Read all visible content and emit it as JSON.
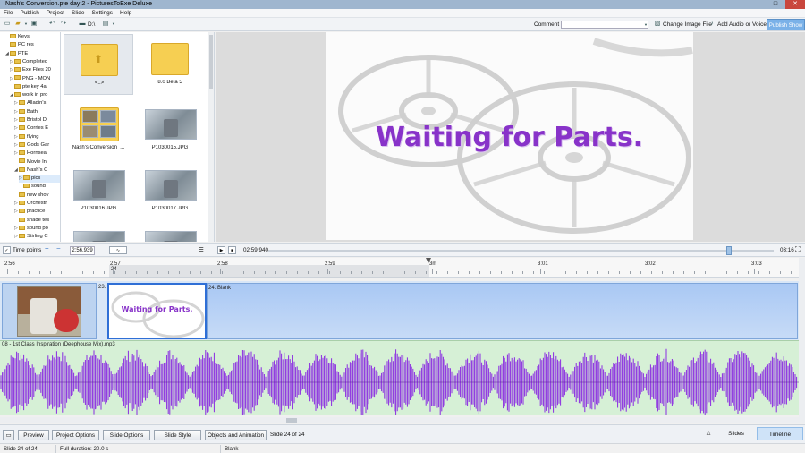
{
  "window": {
    "title": "Nash's Conversion.pte day 2 - PicturesToExe Deluxe",
    "minimize": "—",
    "maximize": "□",
    "close": "✕"
  },
  "menu": [
    "File",
    "Publish",
    "Project",
    "Slide",
    "Settings",
    "Help"
  ],
  "toolbar": {
    "drive_label": "D:\\",
    "comment_label": "Comment",
    "comment_value": "",
    "change_image": "Change Image File",
    "add_audio": "Add Audio or Voice",
    "publish": "Publish Show"
  },
  "tree": [
    {
      "label": "Keys",
      "indent": 0,
      "exp": ""
    },
    {
      "label": "PC res",
      "indent": 0,
      "exp": ""
    },
    {
      "label": "PTE",
      "indent": 0,
      "exp": "◢"
    },
    {
      "label": "Completec",
      "indent": 1,
      "exp": "▷"
    },
    {
      "label": "Exe Files 20",
      "indent": 1,
      "exp": "▷"
    },
    {
      "label": "PNG - MON",
      "indent": 1,
      "exp": "▷"
    },
    {
      "label": "pte key 4a",
      "indent": 1,
      "exp": ""
    },
    {
      "label": "work in pro",
      "indent": 1,
      "exp": "◢"
    },
    {
      "label": "Alladin's",
      "indent": 2,
      "exp": "▷"
    },
    {
      "label": "Bath",
      "indent": 2,
      "exp": "▷"
    },
    {
      "label": "Bristol D",
      "indent": 2,
      "exp": "▷"
    },
    {
      "label": "Corries E",
      "indent": 2,
      "exp": "▷"
    },
    {
      "label": "flying",
      "indent": 2,
      "exp": "▷"
    },
    {
      "label": "Gods Gar",
      "indent": 2,
      "exp": "▷"
    },
    {
      "label": "Hornsea",
      "indent": 2,
      "exp": "▷"
    },
    {
      "label": "Movie In",
      "indent": 2,
      "exp": ""
    },
    {
      "label": "Nash's C",
      "indent": 2,
      "exp": "◢"
    },
    {
      "label": "pics",
      "indent": 3,
      "exp": "▷",
      "sel": true
    },
    {
      "label": "sound",
      "indent": 3,
      "exp": ""
    },
    {
      "label": "new shov",
      "indent": 2,
      "exp": ""
    },
    {
      "label": "Orchestr",
      "indent": 2,
      "exp": "▷"
    },
    {
      "label": "practice",
      "indent": 2,
      "exp": "▷"
    },
    {
      "label": "shade tes",
      "indent": 2,
      "exp": ""
    },
    {
      "label": "sound po",
      "indent": 2,
      "exp": "▷"
    },
    {
      "label": "Stirling C",
      "indent": 2,
      "exp": "▷"
    }
  ],
  "files": [
    {
      "name": "<..>",
      "kind": "up"
    },
    {
      "name": "8.0 Beta 5",
      "kind": "folder"
    },
    {
      "name": "Nash's Conversion_...",
      "kind": "folder-thumb"
    },
    {
      "name": "P1030015.JPG",
      "kind": "photo"
    },
    {
      "name": "P1030016.JPG",
      "kind": "photo"
    },
    {
      "name": "P1030017.JPG",
      "kind": "photo"
    },
    {
      "name": "",
      "kind": "photo"
    },
    {
      "name": "",
      "kind": "photo"
    }
  ],
  "slide": {
    "text": "Waiting for Parts."
  },
  "controls": {
    "time_points": "Time points",
    "time_point_value": "2:56.939",
    "position": "02:59.940",
    "duration": "03:16",
    "slider_fraction": 0.908
  },
  "ruler": {
    "labels": [
      "2:56",
      "2:57",
      "2:58",
      "2:59",
      "3m",
      "3:01",
      "3:02",
      "3:03"
    ],
    "marker": "24"
  },
  "timeline": {
    "slide23": "23.",
    "slide24_label": "24. Blank",
    "slide24_thumb_text": "Waiting for Parts.",
    "audio_name": "08 - 1st Class Inspiration (Deephouse Mix).mp3"
  },
  "bottom": {
    "buttons": [
      "Preview",
      "Project Options",
      "Slide Options",
      "Slide Style",
      "Objects and Animation"
    ],
    "slide_info": "Slide 24 of 24",
    "tab_slides": "Slides",
    "tab_timeline": "Timeline"
  },
  "status": {
    "slide": "Slide 24 of 24",
    "duration": "Full duration: 20.0 s",
    "name": "Blank"
  },
  "colors": {
    "accent": "#7ab1e8",
    "slide_text": "#8833c9",
    "waveform": "#8a2be2",
    "audio_bg": "#d6f0d6"
  }
}
